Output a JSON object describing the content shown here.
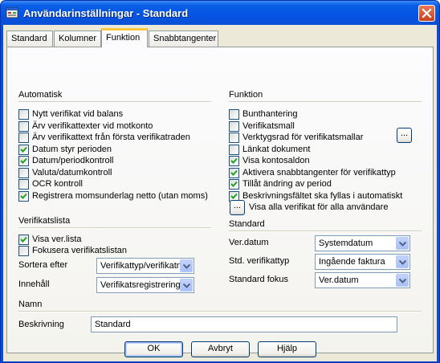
{
  "window": {
    "title": "Användarinställningar - Standard"
  },
  "tabs": [
    "Standard",
    "Kolumner",
    "Funktion",
    "Snabbtangenter"
  ],
  "active_tab": "Funktion",
  "automatisk": {
    "heading": "Automatisk",
    "items": [
      {
        "label": "Nytt verifikat vid balans",
        "checked": false
      },
      {
        "label": "Ärv verifikattexter vid motkonto",
        "checked": false
      },
      {
        "label": "Ärv verifikattext från första verifikatraden",
        "checked": false
      },
      {
        "label": "Datum styr perioden",
        "checked": true
      },
      {
        "label": "Datum/periodkontroll",
        "checked": true
      },
      {
        "label": "Valuta/datumkontroll",
        "checked": false
      },
      {
        "label": "OCR kontroll",
        "checked": false
      },
      {
        "label": "Registrera momsunderlag netto (utan moms)",
        "checked": true
      }
    ]
  },
  "funktion": {
    "heading": "Funktion",
    "items": [
      {
        "label": "Bunthantering",
        "checked": false
      },
      {
        "label": "Verifikatsmall",
        "checked": false
      },
      {
        "label": "Verktygsrad för verifikatsmallar",
        "checked": false
      },
      {
        "label": "Länkat dokument",
        "checked": false
      },
      {
        "label": "Visa kontosaldon",
        "checked": true
      },
      {
        "label": "Aktivera snabbtangenter för verifikattyp",
        "checked": true
      },
      {
        "label": "Tillåt ändring av period",
        "checked": true
      },
      {
        "label": "Beskrivningsfältet ska fyllas i automatiskt",
        "checked": true
      }
    ],
    "ellipsis_label": "...",
    "show_all_label": "Visa alla verifikat för alla användare"
  },
  "verifikatslista": {
    "heading": "Verifikatslista",
    "items": [
      {
        "label": "Visa ver.lista",
        "checked": true
      },
      {
        "label": "Fokusera verifikatslistan",
        "checked": false
      }
    ],
    "sortera_label": "Sortera efter",
    "sortera_value": "Verifikattyp/verifikatnr",
    "innehall_label": "Innehåll",
    "innehall_value": "Verifikatsregistrering"
  },
  "standard": {
    "heading": "Standard",
    "verdatum_label": "Ver.datum",
    "verdatum_value": "Systemdatum",
    "verifikattyp_label": "Std. verifikattyp",
    "verifikattyp_value": "Ingående faktura",
    "fokus_label": "Standard fokus",
    "fokus_value": "Ver.datum"
  },
  "namn": {
    "heading": "Namn",
    "beskrivning_label": "Beskrivning",
    "beskrivning_value": "Standard"
  },
  "buttons": {
    "ok": "OK",
    "avbryt": "Avbryt",
    "hjalp": "Hjälp"
  }
}
